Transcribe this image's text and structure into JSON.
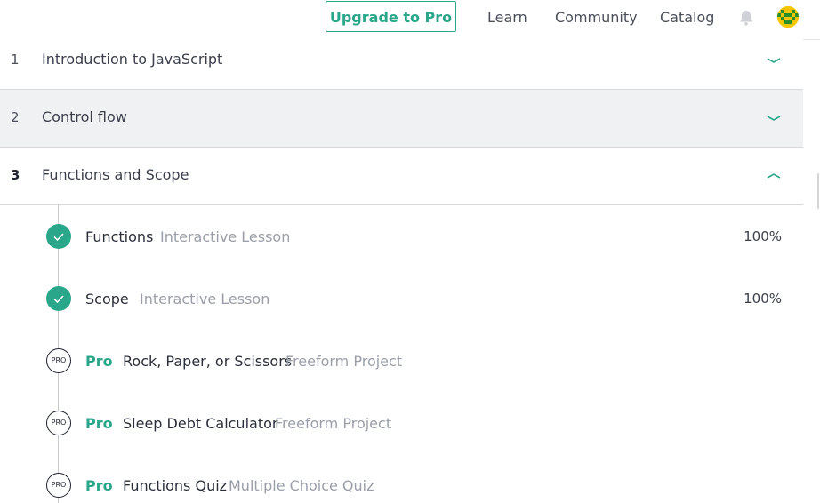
{
  "header": {
    "upgrade_label": "Upgrade to Pro",
    "nav": {
      "learn": "Learn",
      "community": "Community",
      "catalog": "Catalog"
    },
    "accent_color": "#2aa68a"
  },
  "sections": [
    {
      "number": "1",
      "title": "Introduction to JavaScript",
      "expanded": false
    },
    {
      "number": "2",
      "title": "Control flow",
      "expanded": false
    },
    {
      "number": "3",
      "title": "Functions and Scope",
      "expanded": true
    }
  ],
  "lessons": [
    {
      "status": "completed",
      "name": "Functions",
      "type": "Interactive Lesson",
      "progress": "100%"
    },
    {
      "status": "completed",
      "name": "Scope",
      "type": "Interactive Lesson",
      "progress": "100%"
    },
    {
      "status": "pro",
      "badge": "PRO",
      "pro_label": "Pro",
      "name": "Rock, Paper, or Scissors",
      "type": "Freeform Project"
    },
    {
      "status": "pro",
      "badge": "PRO",
      "pro_label": "Pro",
      "name": "Sleep Debt Calculator",
      "type": "Freeform Project"
    },
    {
      "status": "pro",
      "badge": "PRO",
      "pro_label": "Pro",
      "name": "Functions Quiz",
      "type": "Multiple Choice Quiz"
    }
  ]
}
